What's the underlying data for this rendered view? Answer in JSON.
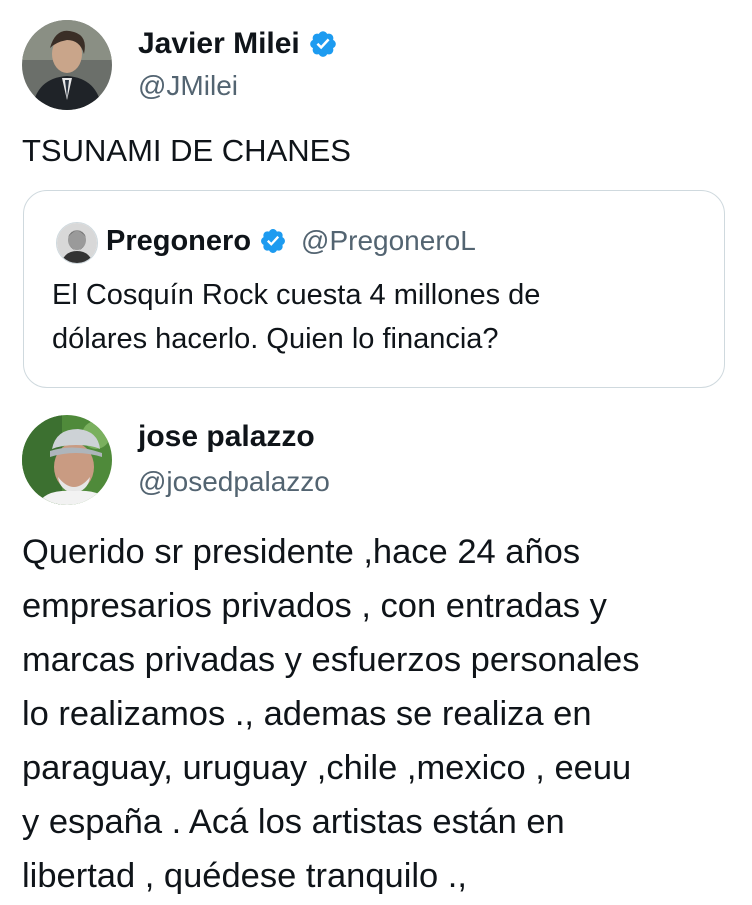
{
  "tweet": {
    "author_name": "Javier Milei",
    "author_handle": "@JMilei",
    "verified_badge_icon": "verified-badge-icon",
    "text": "TSUNAMI DE CHANES"
  },
  "quoted_tweet": {
    "author_name": "Pregonero",
    "author_handle": "@PregoneroL",
    "verified_badge_icon": "verified-badge-icon",
    "text_line1": "El Cosquín Rock cuesta 4 millones de",
    "text_line2": "dólares hacerlo.  Quien lo financia?"
  },
  "reply": {
    "author_name": "jose palazzo",
    "author_handle": "@josedpalazzo",
    "lines": [
      "Querido sr presidente ,hace 24 años",
      "empresarios privados , con entradas y",
      "marcas privadas y esfuerzos personales",
      "lo realizamos ., ademas se realiza en",
      "paraguay, uruguay ,chile ,mexico , eeuu",
      "y españa . Acá los artistas están en",
      "libertad , quédese tranquilo .,"
    ]
  },
  "colors": {
    "verified_blue": "#1d9bf0",
    "handle_gray": "#536471",
    "border": "#cfd9de"
  }
}
